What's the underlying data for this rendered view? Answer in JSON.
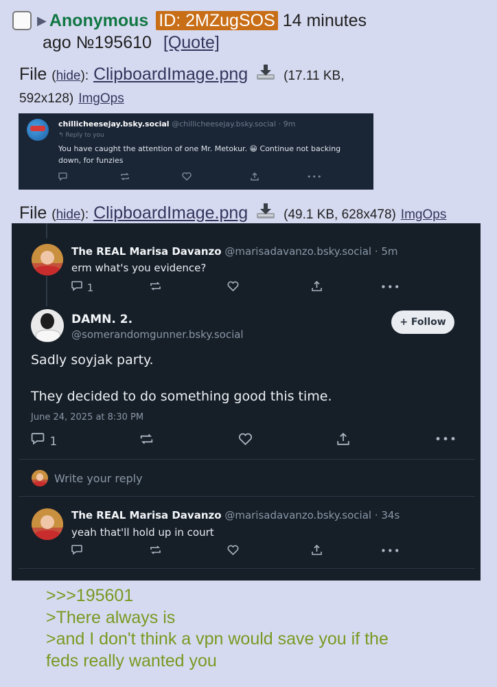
{
  "post": {
    "name": "Anonymous",
    "id_label": "ID: 2MZugSOS",
    "time": "14 minutes",
    "time2": "ago",
    "number": "№195610",
    "quote": "[Quote]"
  },
  "files": [
    {
      "prefix": "File",
      "hide": "hide",
      "filename": "ClipboardImage.png",
      "meta_a": "(17.11 KB,",
      "meta_b": "592x128)",
      "imgops": "ImgOps"
    },
    {
      "prefix": "File",
      "hide": "hide",
      "filename": "ClipboardImage.png",
      "meta": "(49.1 KB, 628x478)",
      "imgops": "ImgOps"
    }
  ],
  "image1": {
    "user": "chillicheesejay.bsky.social",
    "handle": "@chillicheesejay.bsky.social · 9m",
    "reply_to": "↰ Reply to you",
    "text": "You have caught the attention of one Mr. Metokur. 😁 Continue not backing down, for funzies"
  },
  "image2": {
    "post1": {
      "name": "The REAL Marisa Davanzo",
      "handle": "@marisadavanzo.bsky.social · 5m",
      "text": "erm what's you evidence?",
      "reply_count": "1"
    },
    "main": {
      "name": "DAMN. 2.",
      "handle": "@somerandomgunner.bsky.social",
      "follow": "+ Follow",
      "line1": "Sadly soyjak party.",
      "line2": "They decided to do something good this time.",
      "date": "June 24, 2025 at 8:30 PM",
      "reply_count": "1"
    },
    "reply_placeholder": "Write your reply",
    "post2": {
      "name": "The REAL Marisa Davanzo",
      "handle": "@marisadavanzo.bsky.social · 34s",
      "text": "yeah that'll hold up in court"
    }
  },
  "greentext": [
    ">>>195601",
    ">There always is",
    ">and I don't think a vpn would save you if the",
    "feds really wanted you"
  ],
  "colors": {
    "background": "#d6daf0",
    "name": "#117743",
    "id_tag": "#c86e17",
    "link": "#34345c",
    "greentext": "#789922"
  }
}
